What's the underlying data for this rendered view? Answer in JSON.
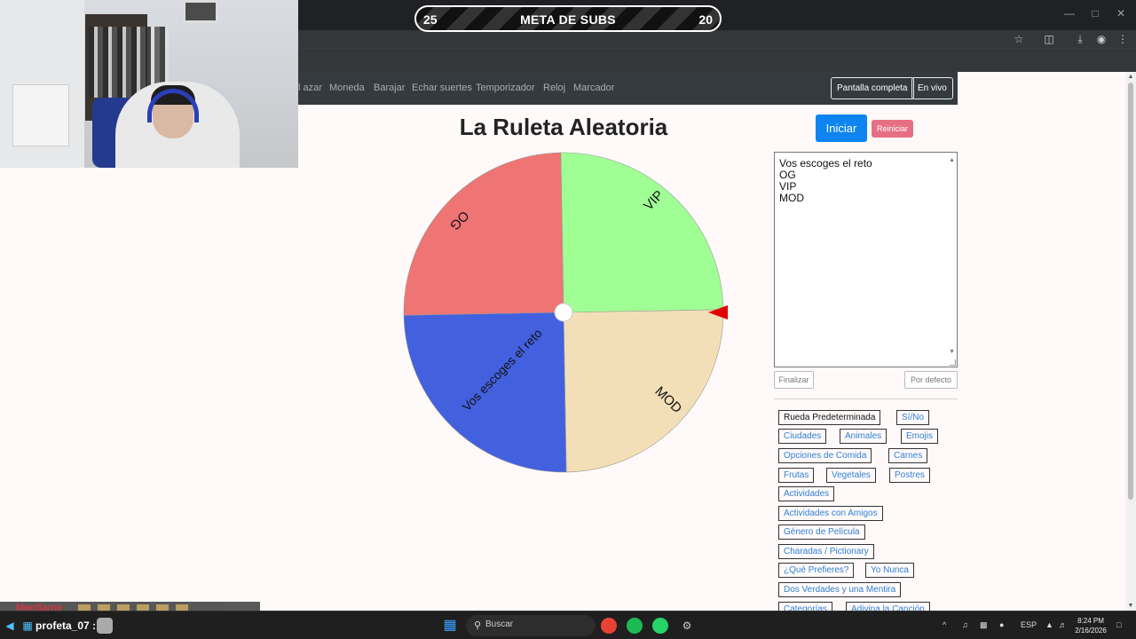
{
  "overlay": {
    "subs_current": "25",
    "subs_title": "META DE SUBS",
    "subs_goal": "20"
  },
  "navbar": {
    "links": [
      "l azar",
      "Moneda",
      "Barajar",
      "Echar suertes",
      "Temporizador",
      "Reloj",
      "Marcador"
    ],
    "fullscreen_label": "Pantalla completa",
    "live_label": "En vivo"
  },
  "page": {
    "title": "La Ruleta Aleatoria"
  },
  "controls": {
    "start_label": "Iniciar",
    "reset_label": "Reiniciar",
    "finish_label": "Finalizar",
    "default_label": "Por defecto"
  },
  "entries": [
    "Vos escoges el reto",
    "OG",
    "VIP",
    "MOD"
  ],
  "wheel": {
    "segments": [
      {
        "label": "VIP",
        "color": "#a0ff94"
      },
      {
        "label": "MOD",
        "color": "#f3dfb7"
      },
      {
        "label": "Vos escoges el reto",
        "color": "#4361de"
      },
      {
        "label": "OG",
        "color": "#ef7474"
      }
    ],
    "pointer_color": "#e00000"
  },
  "presets": [
    "Rueda Predeterminada",
    "Sí/No",
    "Ciudades",
    "Animales",
    "Emojis",
    "Opciones de Comida",
    "Carnes",
    "Frutas",
    "Vegetales",
    "Postres",
    "Actividades",
    "Actividades con Amigos",
    "Género de Película",
    "Charadas / Pictionary",
    "¿Qué Prefieres?",
    "Yo Nunca",
    "Dos Verdades y una Mentira",
    "Categorías",
    "Adivina la Canción"
  ],
  "chat": {
    "user": "Mentlarne",
    "taskbar_user": "profeta_07 :"
  },
  "taskbar": {
    "search_placeholder": "Buscar",
    "lang": "ESP",
    "time": "8:24 PM",
    "date": "2/16/2026"
  }
}
